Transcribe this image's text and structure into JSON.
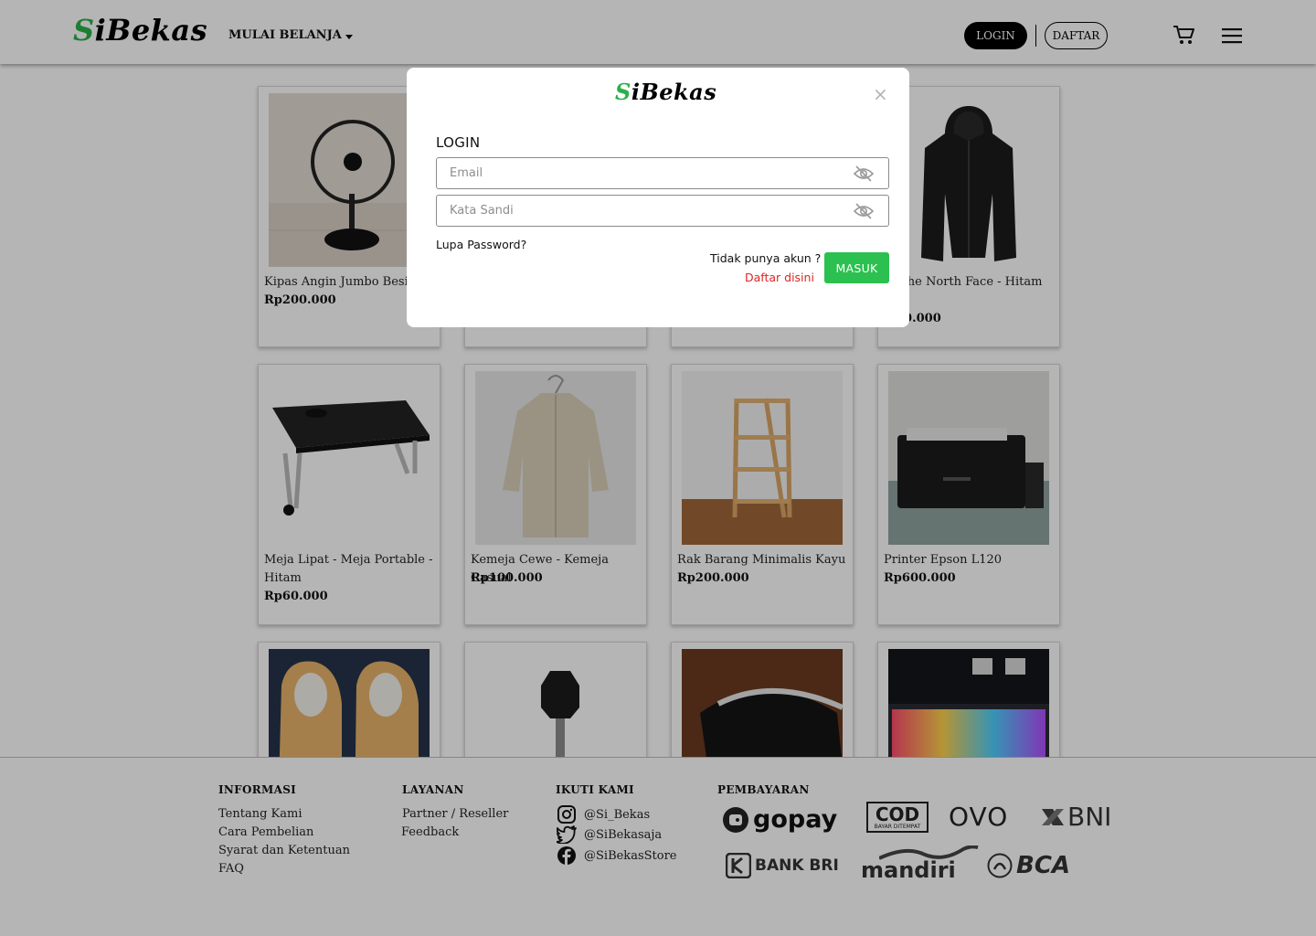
{
  "header": {
    "logo_s": "S",
    "logo_rest": "iBekas",
    "menu_label": "MULAI BELANJA",
    "login_label": "LOGIN",
    "daftar_label": "DAFTAR"
  },
  "products": [
    {
      "name": "Kipas Angin Jumbo Besi",
      "price": "Rp200.000"
    },
    {
      "name": "",
      "price": ""
    },
    {
      "name": "",
      "price": ""
    },
    {
      "name": "… The North Face - Hitam",
      "price": "…00.000"
    },
    {
      "name": "Meja Lipat - Meja Portable - Hitam",
      "price": "Rp60.000"
    },
    {
      "name": "Kemeja Cewe - Kemeja Casual",
      "price": "Rp100.000"
    },
    {
      "name": "Rak Barang Minimalis Kayu",
      "price": "Rp200.000"
    },
    {
      "name": "Printer Epson L120",
      "price": "Rp600.000"
    }
  ],
  "footer": {
    "informasi": {
      "title": "INFORMASI",
      "links": [
        "Tentang Kami",
        "Cara Pembelian",
        "Syarat dan Ketentuan",
        "FAQ"
      ]
    },
    "layanan": {
      "title": "LAYANAN",
      "links": [
        "Partner / Reseller",
        "Feedback"
      ]
    },
    "ikuti": {
      "title": "IKUTI KAMI",
      "instagram": "@Si_Bekas",
      "twitter": "@SiBekasaja",
      "facebook": "@SiBekasStore"
    },
    "pembayaran": {
      "title": "PEMBAYARAN",
      "methods": [
        "gopay",
        "COD",
        "BAYAR DITEMPAT",
        "OVO",
        "BNI",
        "BANK BRI",
        "mandiri",
        "BCA"
      ]
    }
  },
  "modal": {
    "logo_s": "S",
    "logo_rest": "iBekas",
    "close": "×",
    "title": "LOGIN",
    "email_placeholder": "Email",
    "password_placeholder": "Kata Sandi",
    "forgot": "Lupa Password?",
    "no_account": "Tidak punya akun ?",
    "register_link": "Daftar disini",
    "submit": "MASUK"
  },
  "colors": {
    "brand_green": "#2bb14a",
    "button_green": "#2bc04f",
    "link_red": "#e02424"
  }
}
